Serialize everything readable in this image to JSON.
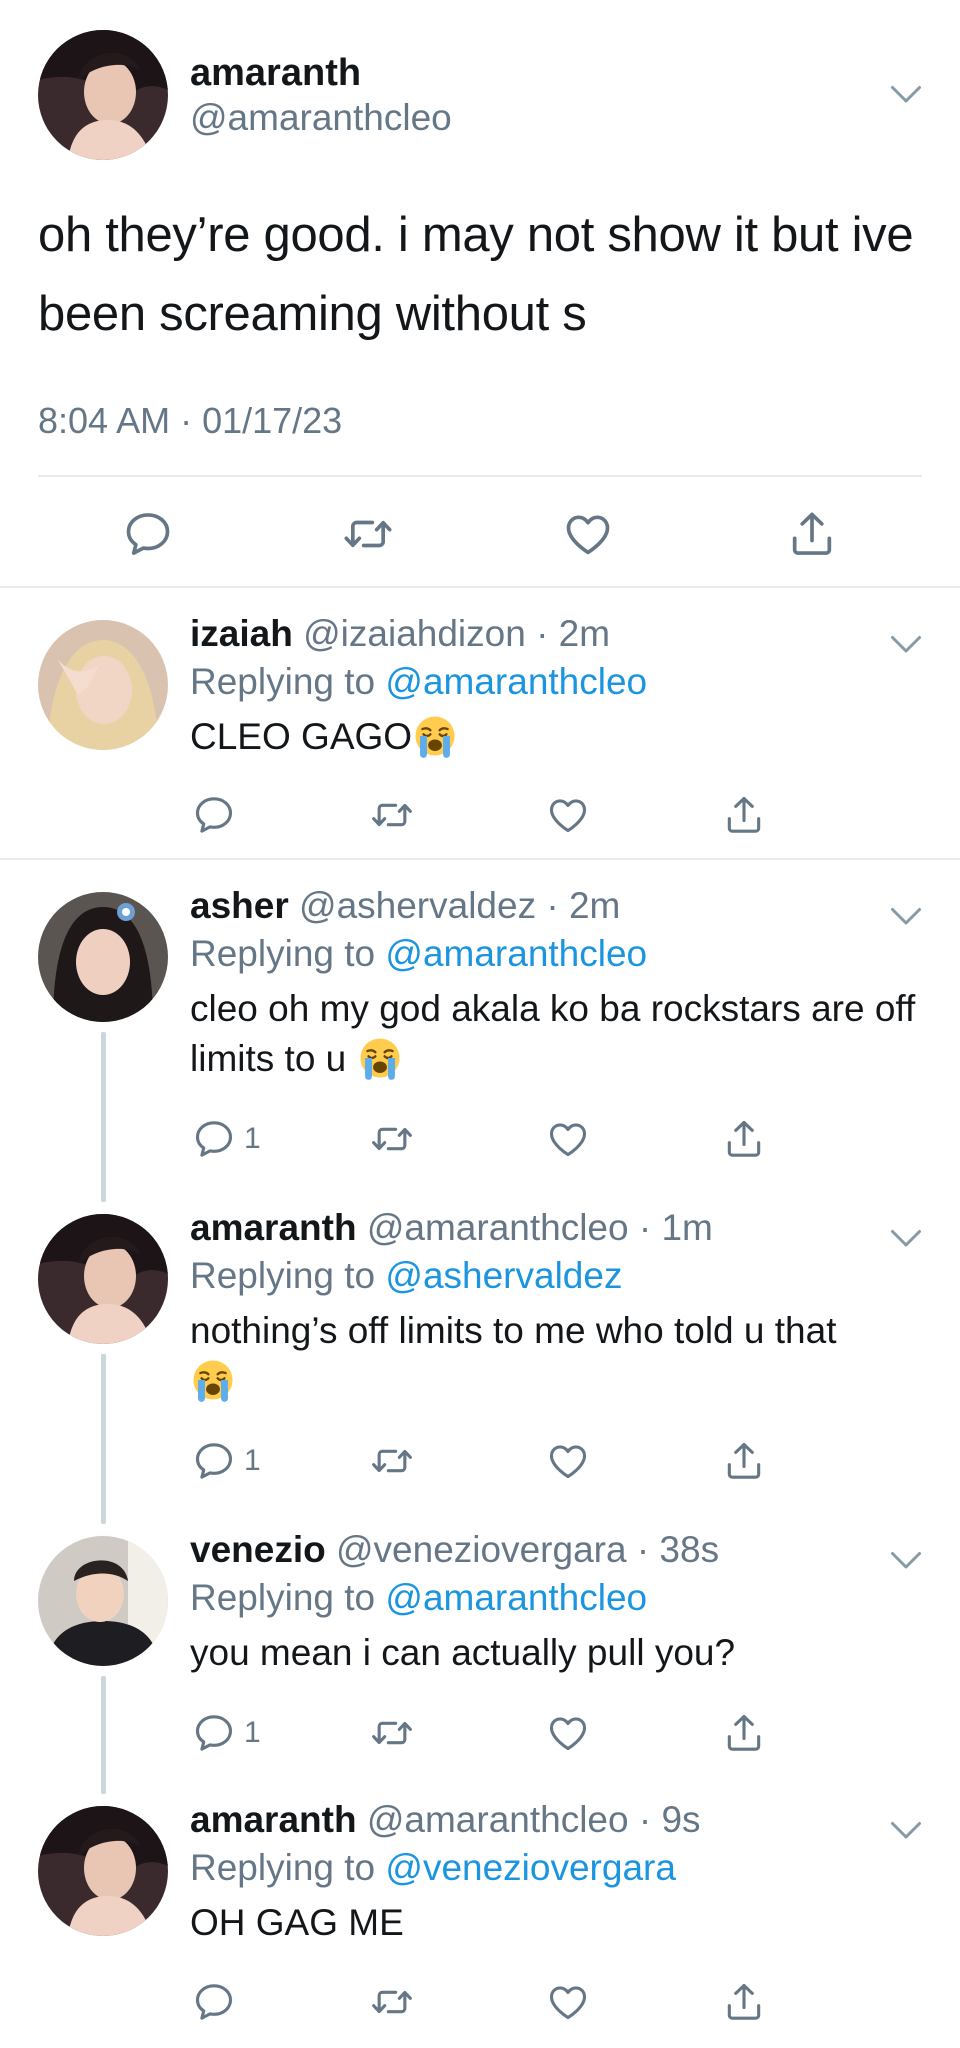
{
  "main_tweet": {
    "display_name": "amaranth",
    "handle": "@amaranthcleo",
    "text": "oh they’re good. i may not show it but ive been screaming without s",
    "timestamp": "8:04 AM · 01/17/23",
    "actions": [
      "reply-icon",
      "retweet-icon",
      "like-icon",
      "share-icon"
    ]
  },
  "replies": [
    {
      "display_name": "izaiah",
      "handle": "@izaiahdizon",
      "age": "· 2m",
      "replying_prefix": "Replying to",
      "replying_to": "@amaranthcleo",
      "text": "CLEO GAGO",
      "emoji": "loudly-crying-face",
      "reply_count": ""
    },
    {
      "display_name": "asher",
      "handle": "@ashervaldez",
      "age": "· 2m",
      "replying_prefix": "Replying to",
      "replying_to": "@amaranthcleo",
      "text": "cleo oh my god akala ko ba rockstars are off limits to u",
      "emoji": "loudly-crying-face",
      "reply_count": "1"
    },
    {
      "display_name": "amaranth",
      "handle": "@amaranthcleo",
      "age": "· 1m",
      "replying_prefix": "Replying to",
      "replying_to": "@ashervaldez",
      "text": "nothing’s off limits to me who told u that",
      "emoji": "loudly-crying-face",
      "reply_count": "1"
    },
    {
      "display_name": "venezio",
      "handle": "@veneziovergara",
      "age": "· 38s",
      "replying_prefix": "Replying to",
      "replying_to": "@amaranthcleo",
      "text": "you mean i can actually pull you?",
      "reply_count": "1"
    },
    {
      "display_name": "amaranth",
      "handle": "@amaranthcleo",
      "age": "· 9s",
      "replying_prefix": "Replying to",
      "replying_to": "@veneziovergara",
      "text": "OH GAG ME",
      "reply_count": ""
    }
  ],
  "colors": {
    "text": "#14171a",
    "secondary": "#657786",
    "link": "#1b95e0",
    "divider": "#e6ecf0",
    "thread_line": "#ccd6dd"
  }
}
